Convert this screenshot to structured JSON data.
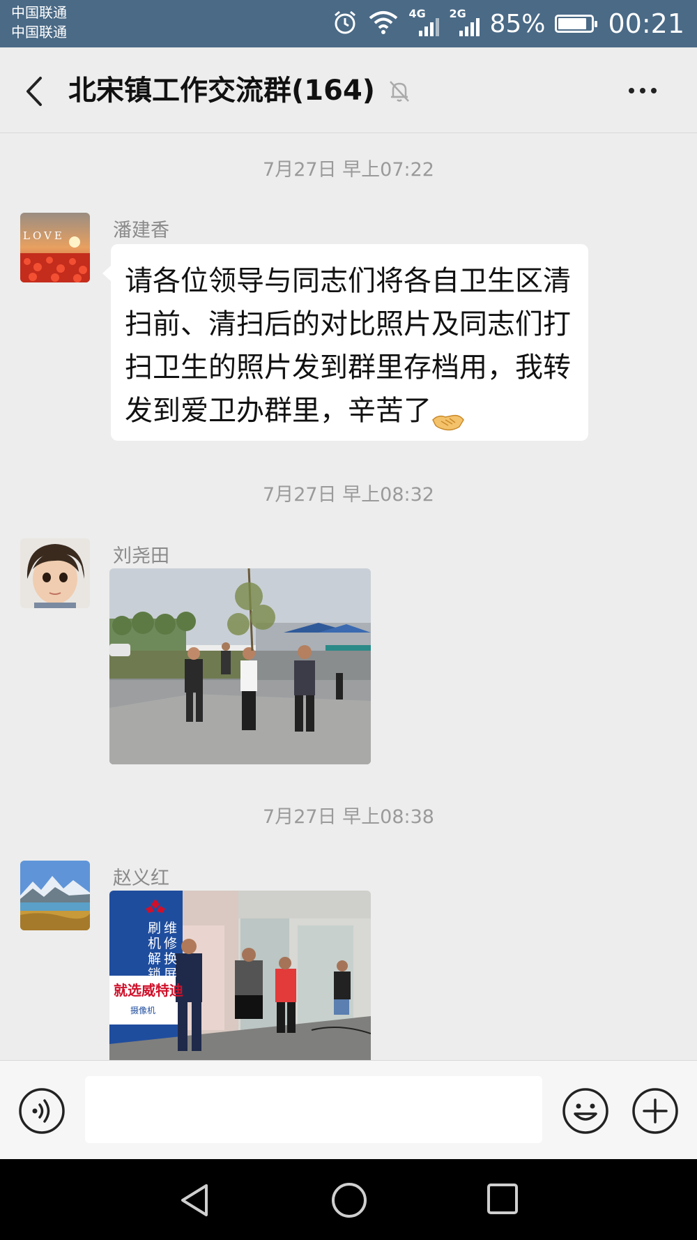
{
  "status_bar": {
    "carrier_1": "中国联通",
    "carrier_2": "中国联通",
    "network_1": "4G",
    "network_2": "2G",
    "battery_percent": "85%",
    "battery_level": 0.85,
    "time": "00:21",
    "icons": [
      "alarm-icon",
      "wifi-icon",
      "signal-icon",
      "battery-icon"
    ]
  },
  "header": {
    "title": "北宋镇工作交流群(164)",
    "icons": [
      "back-arrow-icon",
      "mute-bell-icon",
      "more-dots-icon"
    ]
  },
  "messages": [
    {
      "timestamp": "7月27日 早上07:22",
      "sender": "潘建香",
      "type": "text",
      "text": "请各位领导与同志们将各自卫生区清扫前、清扫后的对比照片及同志们打扫卫生的照片发到群里存档用，我转发到爱卫办群里，辛苦了",
      "avatar_text": "LOVE",
      "trailing_emoji": "handshake-emoji"
    },
    {
      "timestamp": "7月27日 早上08:32",
      "sender": "刘尧田",
      "type": "image"
    },
    {
      "timestamp": "7月27日 早上08:38",
      "sender": "赵义红",
      "type": "image",
      "photo_sign": {
        "left": "刷\n机\n解\n锁",
        "right": "维\n修\n换\n屏",
        "banner": "就选威特迪",
        "camera": "摄像机"
      }
    }
  ],
  "input_bar": {
    "value": "",
    "icons": [
      "voice-icon",
      "emoji-icon",
      "plus-icon"
    ]
  },
  "nav_bar": {
    "icons": [
      "nav-back-icon",
      "nav-home-icon",
      "nav-recent-icon"
    ]
  },
  "colors": {
    "status_bar_bg": "#4a6a86",
    "chat_bg": "#ededed",
    "bubble_bg": "#ffffff",
    "timestamp_text": "#9a9a9a",
    "nav_bar_bg": "#000000"
  }
}
